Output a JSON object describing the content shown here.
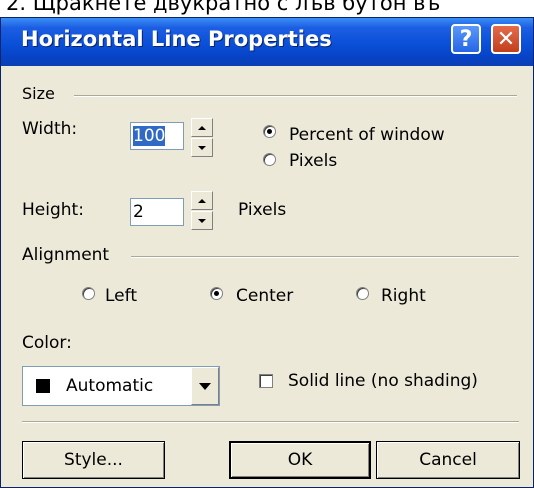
{
  "background_caption": "2. Щракнете двукратно с лъв бутон въ",
  "dialog": {
    "title": "Horizontal Line Properties",
    "help_glyph": "?",
    "close_glyph": "✕"
  },
  "size": {
    "group_label": "Size",
    "width_label": "Width:",
    "width_value": "100",
    "width_units": {
      "options": [
        "Percent of window",
        "Pixels"
      ],
      "selected": "Percent of window"
    },
    "height_label": "Height:",
    "height_value": "2",
    "height_units_label": "Pixels"
  },
  "alignment": {
    "group_label": "Alignment",
    "options": [
      "Left",
      "Center",
      "Right"
    ],
    "selected": "Center"
  },
  "color": {
    "label": "Color:",
    "value": "Automatic",
    "swatch": "#000000"
  },
  "solid_line": {
    "label": "Solid line (no shading)",
    "checked": false
  },
  "buttons": {
    "style": "Style...",
    "ok": "OK",
    "cancel": "Cancel"
  },
  "colors": {
    "titlebar": "#0a4fd8",
    "dialog_bg": "#ece9d8",
    "close_button": "#c2401c",
    "selection": "#316ac5"
  }
}
